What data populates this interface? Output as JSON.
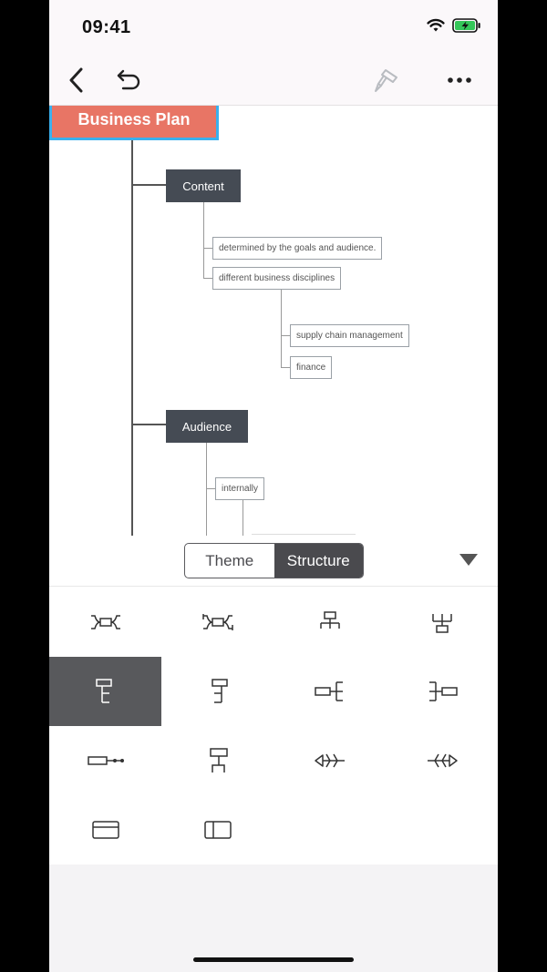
{
  "status": {
    "time": "09:41"
  },
  "mindmap": {
    "root": "Business Plan",
    "topics": [
      {
        "label": "Content",
        "children": [
          "determined by the goals and audience.",
          "different business disciplines"
        ],
        "grandchildren": [
          "supply chain management",
          "finance"
        ]
      },
      {
        "label": "Audience",
        "children": [
          "internally"
        ]
      }
    ]
  },
  "tabs": {
    "theme": "Theme",
    "structure": "Structure",
    "selected": "Structure"
  },
  "structures": [
    "mindmap-structure-icon",
    "mindmap-clockwise-structure-icon",
    "org-chart-down-icon",
    "org-chart-up-icon",
    "tree-right-structure-icon",
    "tree-left-structure-icon",
    "logic-left-structure-icon",
    "logic-right-structure-icon",
    "timeline-structure-icon",
    "tree-table-structure-icon",
    "fishbone-left-icon",
    "fishbone-right-icon",
    "matrix-row-icon",
    "matrix-column-icon"
  ],
  "selected_structure_index": 4,
  "colors": {
    "root": "#e87565",
    "root_border": "#3ab0ee",
    "topic": "#454b54",
    "selected_cell": "#58595c",
    "battery": "#34c759"
  }
}
